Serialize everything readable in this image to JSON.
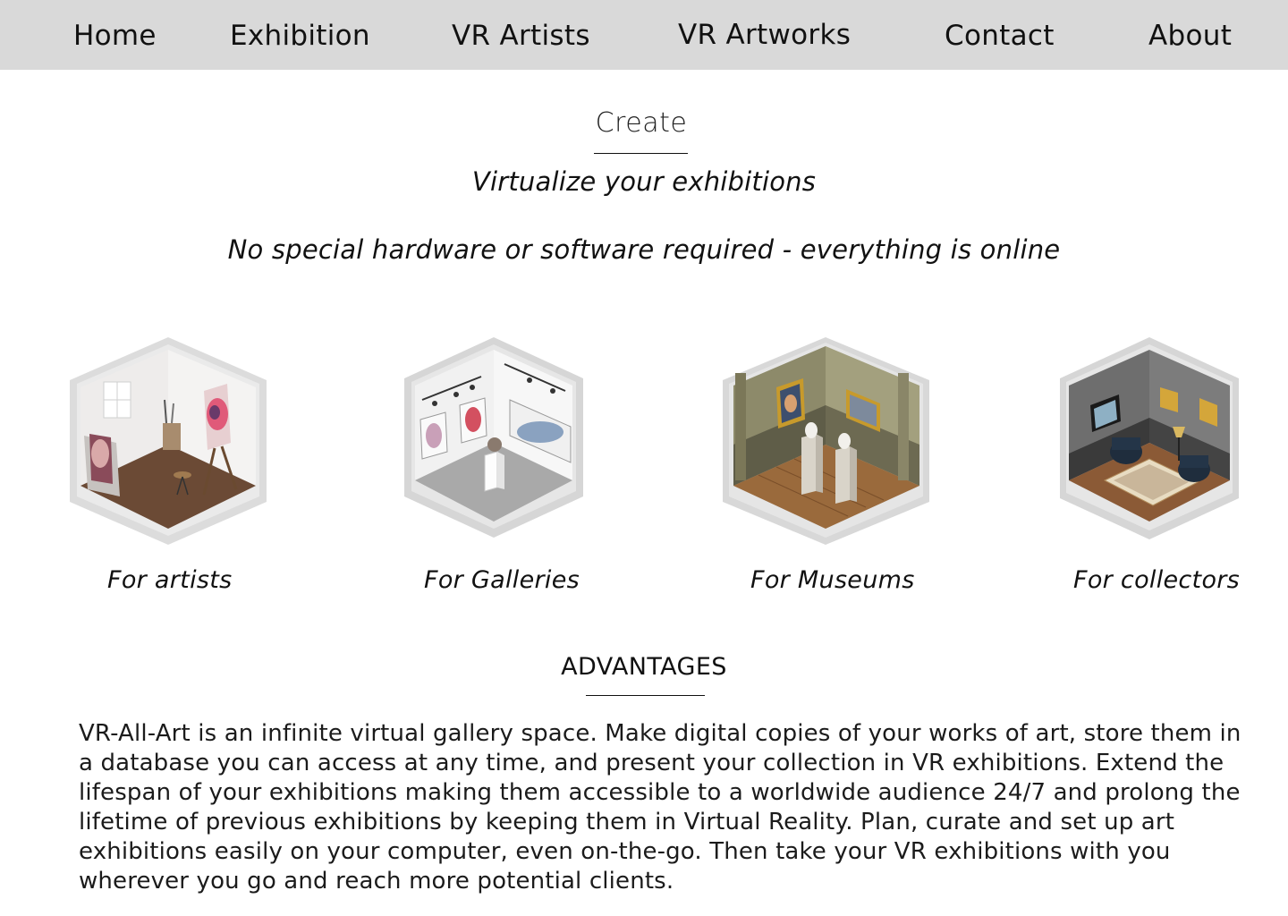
{
  "nav": {
    "home": "Home",
    "exhibition": "Exhibition",
    "vr_artists": "VR Artists",
    "vr_artworks": "VR Artworks",
    "contact": "Contact",
    "about": "About"
  },
  "hero": {
    "heading": "Create",
    "tagline": "Virtualize your exhibitions",
    "subtagline": "No special hardware or software required - everything is online"
  },
  "cards": [
    {
      "label": "For artists",
      "icon": "artist-studio-room"
    },
    {
      "label": "For Galleries",
      "icon": "gallery-room"
    },
    {
      "label": "For Museums",
      "icon": "museum-room"
    },
    {
      "label": "For collectors",
      "icon": "collector-room"
    }
  ],
  "advantages": {
    "heading": "ADVANTAGES",
    "body": "VR-All-Art is an infinite virtual gallery space. Make digital copies of your works of art, store them in a database you can access at any time, and present your collection in VR exhibitions. Extend the lifespan of your exhibitions making them accessible to a worldwide audience 24/7 and prolong the lifetime of previous exhibitions by keeping them in Virtual Reality. Plan, curate and set up art exhibitions easily on your computer, even on-the-go. Then take your VR exhibitions with you wherever you go and reach more potential clients."
  },
  "colors": {
    "nav_background": "#d9d9d9",
    "page_background": "#ffffff",
    "text": "#111111"
  }
}
